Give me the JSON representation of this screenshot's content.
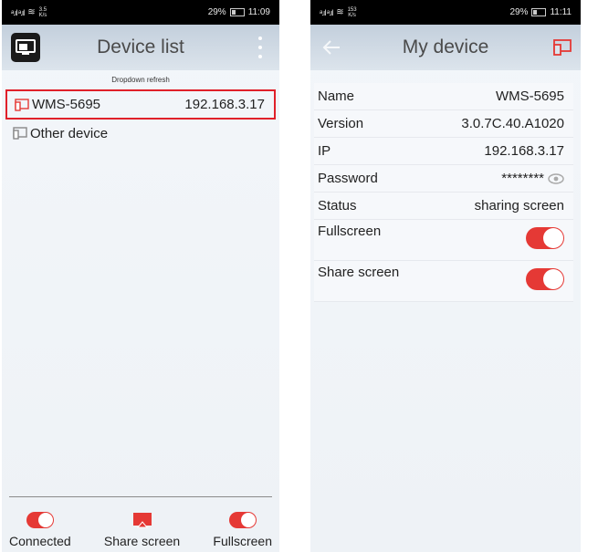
{
  "left": {
    "status": {
      "speed_top": "3.5",
      "speed_bottom": "K/s",
      "battery": "29%",
      "time": "11:09"
    },
    "title": "Device list",
    "dropdown_hint": "Dropdown refresh",
    "devices": [
      {
        "name": "WMS-5695",
        "ip": "192.168.3.17"
      },
      {
        "name": "Other device",
        "ip": ""
      }
    ],
    "bottom": {
      "connected": "Connected",
      "share": "Share screen",
      "fullscreen": "Fullscreen"
    }
  },
  "right": {
    "status": {
      "speed_top": "153",
      "speed_bottom": "K/s",
      "battery": "29%",
      "time": "11:11"
    },
    "title": "My device",
    "rows": {
      "name": {
        "label": "Name",
        "value": "WMS-5695"
      },
      "version": {
        "label": "Version",
        "value": "3.0.7C.40.A1020"
      },
      "ip": {
        "label": "IP",
        "value": "192.168.3.17"
      },
      "password": {
        "label": "Password",
        "value": "********"
      },
      "status": {
        "label": "Status",
        "value": "sharing screen"
      },
      "fullscreen": {
        "label": "Fullscreen"
      },
      "share": {
        "label": "Share screen"
      }
    }
  },
  "colors": {
    "accent": "#e53935",
    "highlight": "#e0202a"
  },
  "icons": [
    "app-icon",
    "kebab-menu-icon",
    "device-icon",
    "back-icon",
    "cast-icon",
    "eye-icon",
    "share-screen-icon"
  ]
}
